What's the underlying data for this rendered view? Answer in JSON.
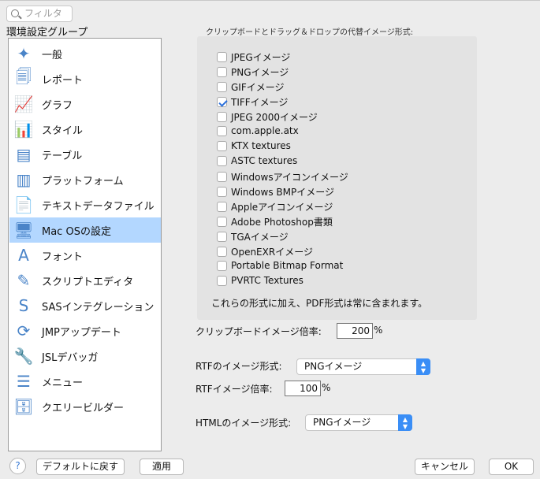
{
  "filter": {
    "placeholder": "フィルタ"
  },
  "sidebar": {
    "title": "環境設定グループ",
    "items": [
      {
        "label": "一般",
        "icon": "jmp-star-icon"
      },
      {
        "label": "レポート",
        "icon": "report-icon"
      },
      {
        "label": "グラフ",
        "icon": "graph-icon"
      },
      {
        "label": "スタイル",
        "icon": "style-icon"
      },
      {
        "label": "テーブル",
        "icon": "table-icon"
      },
      {
        "label": "プラットフォーム",
        "icon": "platform-icon"
      },
      {
        "label": "テキストデータファイル",
        "icon": "text-file-icon"
      },
      {
        "label": "Mac OSの設定",
        "icon": "monitor-icon",
        "selected": true
      },
      {
        "label": "フォント",
        "icon": "font-icon"
      },
      {
        "label": "スクリプトエディタ",
        "icon": "script-editor-icon"
      },
      {
        "label": "SASインテグレーション",
        "icon": "sas-icon"
      },
      {
        "label": "JMPアップデート",
        "icon": "update-icon"
      },
      {
        "label": "JSLデバッガ",
        "icon": "debugger-icon"
      },
      {
        "label": "メニュー",
        "icon": "menu-icon"
      },
      {
        "label": "クエリービルダー",
        "icon": "query-builder-icon"
      }
    ]
  },
  "main": {
    "caption": "クリップボードとドラッグ＆ドロップの代替イメージ形式:",
    "formats": [
      {
        "label": "JPEGイメージ",
        "checked": false
      },
      {
        "label": "PNGイメージ",
        "checked": false
      },
      {
        "label": "GIFイメージ",
        "checked": false
      },
      {
        "label": "TIFFイメージ",
        "checked": true
      },
      {
        "label": "JPEG 2000イメージ",
        "checked": false
      },
      {
        "label": "com.apple.atx",
        "checked": false
      },
      {
        "label": "KTX textures",
        "checked": false
      },
      {
        "label": "ASTC textures",
        "checked": false
      },
      {
        "label": "Windowsアイコンイメージ",
        "checked": false
      },
      {
        "label": "Windows BMPイメージ",
        "checked": false
      },
      {
        "label": "Appleアイコンイメージ",
        "checked": false
      },
      {
        "label": "Adobe Photoshop書類",
        "checked": false
      },
      {
        "label": "TGAイメージ",
        "checked": false
      },
      {
        "label": "OpenEXRイメージ",
        "checked": false
      },
      {
        "label": "Portable Bitmap Format",
        "checked": false
      },
      {
        "label": "PVRTC Textures",
        "checked": false
      }
    ],
    "note": "これらの形式に加え、PDF形式は常に含まれます。",
    "clip_scale_label": "クリップボードイメージ倍率:",
    "clip_scale": "200",
    "percent": "%",
    "rtf_format_label": "RTFのイメージ形式:",
    "rtf_format": "PNGイメージ",
    "rtf_scale_label": "RTFイメージ倍率:",
    "rtf_scale": "100",
    "html_format_label": "HTMLのイメージ形式:",
    "html_format": "PNGイメージ"
  },
  "footer": {
    "help": "?",
    "reset": "デフォルトに戻す",
    "apply": "適用",
    "cancel": "キャンセル",
    "ok": "OK"
  }
}
